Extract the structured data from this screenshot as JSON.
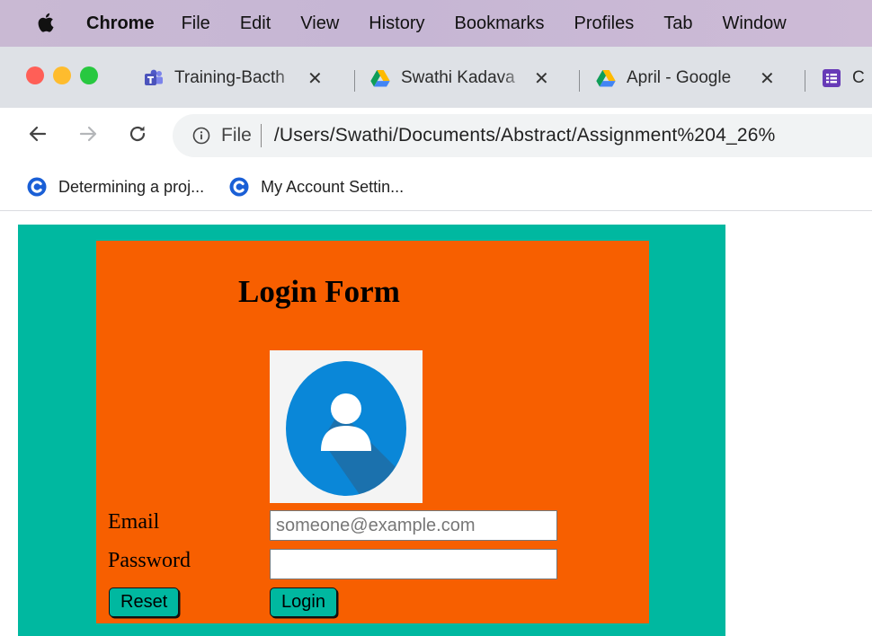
{
  "menubar": {
    "icon": "apple-icon",
    "items": [
      "Chrome",
      "File",
      "Edit",
      "View",
      "History",
      "Bookmarks",
      "Profiles",
      "Tab",
      "Window"
    ]
  },
  "tabs": [
    {
      "label": "Training-Bacth",
      "icon": "teams-icon"
    },
    {
      "label": "Swathi Kadava",
      "icon": "google-drive-icon"
    },
    {
      "label": "April - Google",
      "icon": "google-drive-icon"
    },
    {
      "label": "C",
      "icon": "google-forms-icon"
    }
  ],
  "omnibox": {
    "scheme": "File",
    "path": "/Users/Swathi/Documents/Abstract/Assignment%204_26%"
  },
  "bookmarks": [
    {
      "label": "Determining a proj...",
      "icon": "c-logo-icon"
    },
    {
      "label": "My Account Settin...",
      "icon": "c-logo-icon"
    }
  ],
  "form": {
    "title": "Login Form",
    "email_label": "Email",
    "email_placeholder": "someone@example.com",
    "email_value": "",
    "password_label": "Password",
    "password_value": "",
    "reset_label": "Reset",
    "login_label": "Login"
  },
  "colors": {
    "page_bg": "#00b8a0",
    "form_bg": "#f75f00",
    "avatar_blue": "#0a87d8",
    "button_bg": "#00b8a0"
  }
}
